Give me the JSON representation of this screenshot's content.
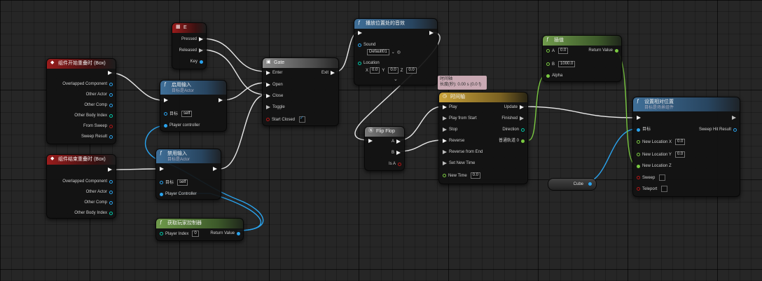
{
  "nodes": {
    "begin_overlap": {
      "title": "组件开始重叠时 (Box)",
      "pins": [
        "Overlapped Component",
        "Other Actor",
        "Other Comp",
        "Other Body Index",
        "From Sweep",
        "Sweep Result"
      ]
    },
    "end_overlap": {
      "title": "组件结束重叠时 (Box)",
      "pins": [
        "Overlapped Component",
        "Other Actor",
        "Other Comp",
        "Other Body Index"
      ]
    },
    "key_e": {
      "title": "E",
      "pins": [
        "Pressed",
        "Released",
        "Key"
      ]
    },
    "enable_input": {
      "title": "启用输入",
      "subtitle": "目标是Actor",
      "target_label": "目标",
      "target_value": "self",
      "pin_controller": "Player controller"
    },
    "disable_input": {
      "title": "禁用输入",
      "subtitle": "目标是Actor",
      "target_label": "目标",
      "target_value": "self",
      "pin_controller": "Player Controller"
    },
    "get_player_controller": {
      "title": "获取玩家控制器",
      "pin_index": "Player Index",
      "index_value": "0",
      "pin_return": "Return Value"
    },
    "gate": {
      "title": "Gate",
      "pins": [
        "Enter",
        "Open",
        "Close",
        "Toggle",
        "Start Closed"
      ],
      "exit": "Exit"
    },
    "play_sound": {
      "title": "播放位置处的音效",
      "sound_label": "Sound",
      "sound_value": "Default01",
      "location_label": "Location",
      "loc_x": "0.0",
      "loc_y": "0.0",
      "loc_z": "0.0",
      "axis_x": "X",
      "axis_y": "Y",
      "axis_z": "Z"
    },
    "flipflop": {
      "title": "Flip Flop",
      "pins": [
        "A",
        "B",
        "Is A"
      ]
    },
    "timeline": {
      "title": "时间轴",
      "inputs": [
        "Play",
        "Play from Start",
        "Stop",
        "Reverse",
        "Reverse from End",
        "Set New Time",
        "New Time"
      ],
      "outputs": [
        "Update",
        "Finished",
        "Direction",
        "普通轨道 0"
      ],
      "new_time_value": "0.0"
    },
    "lerp": {
      "title": "插值",
      "a_label": "A",
      "a_value": "0.0",
      "b_label": "B",
      "b_value": "1000.0",
      "alpha_label": "Alpha",
      "return_label": "Return Value"
    },
    "set_location": {
      "title": "设置相对位置",
      "subtitle": "目标是场景组件",
      "target_label": "目标",
      "sweep_hit": "Sweep Hit Result",
      "loc_x_label": "New Location X",
      "loc_x": "0.0",
      "loc_y_label": "New Location Y",
      "loc_y": "0.0",
      "loc_z_label": "New Location Z",
      "sweep_label": "Sweep",
      "teleport_label": "Teleport"
    },
    "cube": {
      "label": "Cube"
    }
  },
  "comment": {
    "line1": "时间轴",
    "line2": "长度(秒): 0.00 s (0.0 f)"
  },
  "colors": {
    "exec": "#f2f2f2",
    "object": "#2aa4ef",
    "float": "#7ac941",
    "bool": "#b31515",
    "struct": "#00c9a8",
    "int": "#1fe0c0"
  }
}
